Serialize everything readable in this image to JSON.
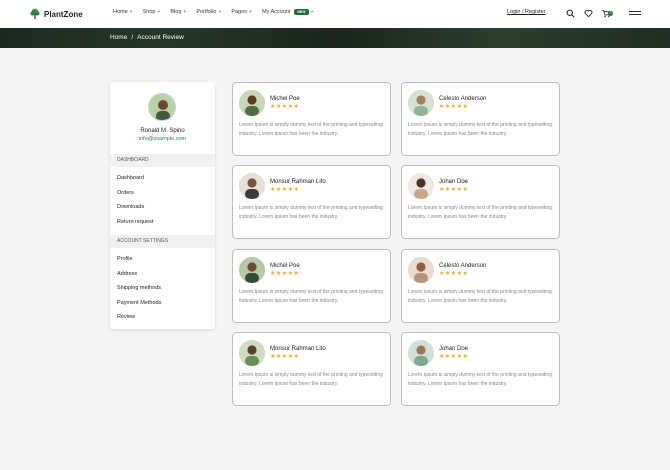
{
  "brand": {
    "name": "PlantZone",
    "accent": "#1f6b3a"
  },
  "nav": {
    "items": [
      {
        "label": "Home"
      },
      {
        "label": "Shop"
      },
      {
        "label": "Blog"
      },
      {
        "label": "Portfolio"
      },
      {
        "label": "Pages"
      },
      {
        "label": "My Account",
        "badge": "NEW"
      }
    ],
    "login_label": "Login / Register",
    "cart_count": "0"
  },
  "breadcrumb": {
    "home": "Home",
    "separator": "/",
    "current": "Account Review"
  },
  "profile": {
    "name": "Ronald M. Spino",
    "email": "info@example.com"
  },
  "sidebar": {
    "dashboard_head": "DASHBOARD",
    "dashboard_items": [
      "Dashboard",
      "Orders",
      "Downloads",
      "Return request"
    ],
    "settings_head": "ACCOUNT SETTINGS",
    "settings_items": [
      "Profile",
      "Address",
      "Shipping methods",
      "Payment Methods",
      "Review"
    ]
  },
  "reviews": [
    {
      "name": "Michel Poe",
      "stars": "★★★★★",
      "text": "Lorem Ipsum is simply dummy text of the printing and typesetting industry. Lorem Ipsum has been the industry."
    },
    {
      "name": "Celesto Anderson",
      "stars": "★★★★★",
      "text": "Lorem Ipsum is simply dummy text of the printing and typesetting industry. Lorem Ipsum has been the industry."
    },
    {
      "name": "Monsur Rahman Lito",
      "stars": "★★★★★",
      "text": "Lorem Ipsum is simply dummy text of the printing and typesetting industry. Lorem Ipsum has been the industry."
    },
    {
      "name": "Johan Doe",
      "stars": "★★★★★",
      "text": "Lorem Ipsum is simply dummy text of the printing and typesetting industry. Lorem Ipsum has been the industry."
    },
    {
      "name": "Michel Poe",
      "stars": "★★★★★",
      "text": "Lorem Ipsum is simply dummy text of the printing and typesetting industry. Lorem Ipsum has been the industry."
    },
    {
      "name": "Celesto Anderson",
      "stars": "★★★★★",
      "text": "Lorem Ipsum is simply dummy text of the printing and typesetting industry. Lorem Ipsum has been the industry."
    },
    {
      "name": "Monsur Rahman Lito",
      "stars": "★★★★★",
      "text": "Lorem Ipsum is simply dummy text of the printing and typesetting industry. Lorem Ipsum has been the industry."
    },
    {
      "name": "Johan Doe",
      "stars": "★★★★★",
      "text": "Lorem Ipsum is simply dummy text of the printing and typesetting industry. Lorem Ipsum has been the industry."
    }
  ],
  "icons": {
    "logo": "tree-icon",
    "search": "search-icon",
    "wishlist": "heart-icon",
    "cart": "cart-icon",
    "menu": "hamburger-icon",
    "star_color": "#f2a818"
  }
}
